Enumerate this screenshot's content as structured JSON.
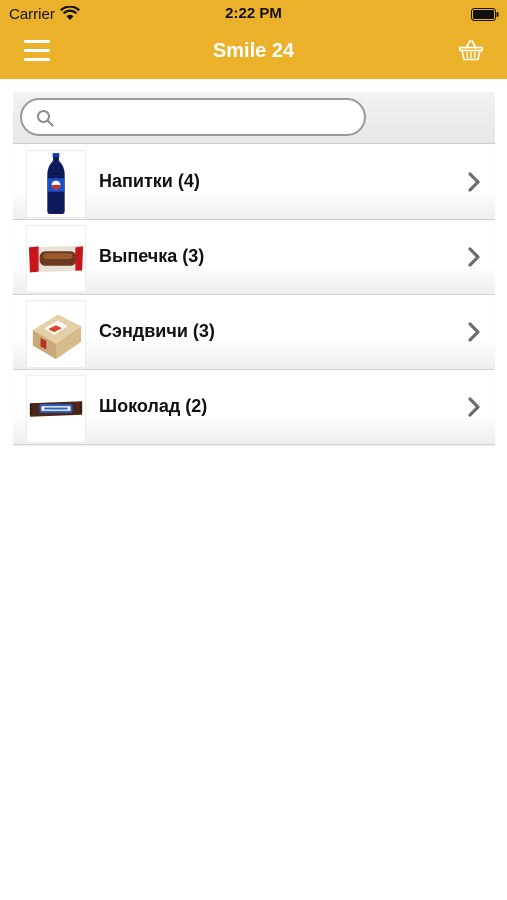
{
  "status_bar": {
    "carrier": "Carrier",
    "time": "2:22 PM",
    "wifi_icon": "wifi-icon",
    "battery_icon": "battery-icon"
  },
  "header": {
    "title": "Smile 24",
    "menu_icon": "menu-icon",
    "basket_icon": "basket-icon",
    "background_color": "#ecb12a"
  },
  "search": {
    "placeholder": "",
    "value": "",
    "icon": "search-icon"
  },
  "categories": [
    {
      "label": "Напитки (4)",
      "thumbnail": "cola-bottle-image"
    },
    {
      "label": "Выпечка (3)",
      "thumbnail": "pastry-pack-image"
    },
    {
      "label": "Сэндвичи (3)",
      "thumbnail": "sandwich-box-image"
    },
    {
      "label": "Шоколад (2)",
      "thumbnail": "chocolate-bar-image"
    }
  ]
}
